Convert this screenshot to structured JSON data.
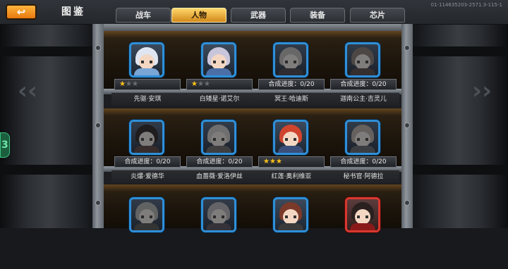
{
  "header": {
    "title": "图鉴",
    "version": "01-114635203-2571.3-115-1",
    "back_icon": "back-arrow-icon"
  },
  "tabs": [
    {
      "label": "战车",
      "active": false
    },
    {
      "label": "人物",
      "active": true
    },
    {
      "label": "武器",
      "active": false
    },
    {
      "label": "装备",
      "active": false
    },
    {
      "label": "芯片",
      "active": false
    }
  ],
  "side": {
    "left_chevron": "‹‹",
    "right_chevron": "››",
    "tab_glyph": "3"
  },
  "characters": [
    {
      "name": "先驱·安琪",
      "status_type": "stars",
      "stars_on": 1,
      "stars_total": 3,
      "status_text": "",
      "frame": "blue",
      "locked": false,
      "hair": "#dfe6f2",
      "body": "#7aa6d6"
    },
    {
      "name": "白矮星·诺艾尔",
      "status_type": "stars",
      "stars_on": 1,
      "stars_total": 3,
      "status_text": "",
      "frame": "blue",
      "locked": false,
      "hair": "#c9c6dc",
      "body": "#4b6ea6"
    },
    {
      "name": "冥王·哈迪斯",
      "status_type": "progress",
      "stars_on": 0,
      "stars_total": 0,
      "status_text": "合成进度：0/20",
      "frame": "blue",
      "locked": true,
      "hair": "#b5b5b5",
      "body": "#5a3d7a"
    },
    {
      "name": "迦南公主·吉灵儿",
      "status_type": "progress",
      "stars_on": 0,
      "stars_total": 0,
      "status_text": "合成进度：0/20",
      "frame": "blue",
      "locked": true,
      "hair": "#b0704a",
      "body": "#9a3a3a"
    },
    {
      "name": "炎爆·爱德华",
      "status_type": "progress",
      "stars_on": 0,
      "stars_total": 0,
      "status_text": "合成进度：0/20",
      "frame": "blue",
      "locked": true,
      "hair": "#3a2a24",
      "body": "#b03222"
    },
    {
      "name": "血蔷薇·爱洛伊丝",
      "status_type": "progress",
      "stars_on": 0,
      "stars_total": 0,
      "status_text": "合成进度：0/20",
      "frame": "blue",
      "locked": true,
      "hair": "#c9c2bd",
      "body": "#6a6a6a"
    },
    {
      "name": "红莲·奥利维亚",
      "status_type": "stars",
      "stars_on": 3,
      "stars_total": 3,
      "status_text": "",
      "frame": "blue",
      "locked": false,
      "hair": "#d0442e",
      "body": "#3b4f7a"
    },
    {
      "name": "秘书官·阿德拉",
      "status_type": "progress",
      "stars_on": 0,
      "stars_total": 0,
      "status_text": "合成进度：0/20",
      "frame": "blue",
      "locked": true,
      "hair": "#e0a070",
      "body": "#3a6ea0"
    },
    {
      "name": "",
      "status_type": "none",
      "stars_on": 0,
      "stars_total": 0,
      "status_text": "",
      "frame": "blue",
      "locked": true,
      "hair": "#9ab0a0",
      "body": "#4a5a4a"
    },
    {
      "name": "",
      "status_type": "none",
      "stars_on": 0,
      "stars_total": 0,
      "status_text": "",
      "frame": "blue",
      "locked": true,
      "hair": "#b8a8c8",
      "body": "#6a4a8a"
    },
    {
      "name": "",
      "status_type": "none",
      "stars_on": 0,
      "stars_total": 0,
      "status_text": "",
      "frame": "blue",
      "locked": false,
      "hair": "#7a3a2a",
      "body": "#3a3a3a"
    },
    {
      "name": "",
      "status_type": "none",
      "stars_on": 0,
      "stars_total": 0,
      "status_text": "",
      "frame": "red",
      "locked": false,
      "hair": "#2a2020",
      "body": "#8a1a1a"
    }
  ],
  "colors": {
    "tab_active": "#ffd76a",
    "frame_blue": "#2f8fd8",
    "frame_red": "#d8382f",
    "star_on": "#ffc21a",
    "back_button": "#f39b25"
  }
}
